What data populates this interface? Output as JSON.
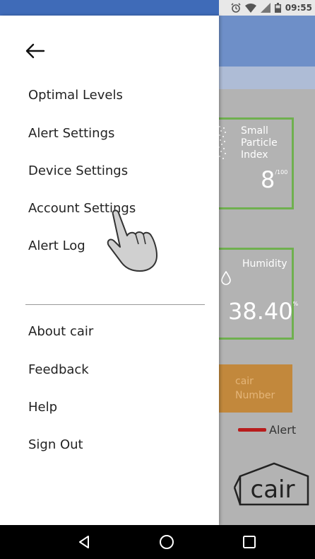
{
  "status_bar": {
    "time": "09:55",
    "icons": [
      "alarm-icon",
      "wifi-icon",
      "signal-icon",
      "battery-icon"
    ]
  },
  "background": {
    "small_particle_card": {
      "label_lines": [
        "Small",
        "Particle",
        "Index"
      ],
      "value": "8",
      "unit": "/100"
    },
    "humidity_card": {
      "label": "Humidity",
      "value": "38.40",
      "unit": "%"
    },
    "cair_number_box": {
      "lines": [
        "cair",
        "Number"
      ]
    },
    "legend": {
      "label": "Alert",
      "color": "#b81c1c"
    },
    "logo_text": "cair"
  },
  "drawer": {
    "primary_items": [
      {
        "label": "Optimal Levels"
      },
      {
        "label": "Alert Settings"
      },
      {
        "label": "Device Settings"
      },
      {
        "label": "Account Settings"
      },
      {
        "label": "Alert Log"
      }
    ],
    "secondary_items": [
      {
        "label": "About cair"
      },
      {
        "label": "Feedback"
      },
      {
        "label": "Help"
      },
      {
        "label": "Sign Out"
      }
    ]
  },
  "nav_bar": {
    "buttons": [
      "back-triangle-icon",
      "home-circle-icon",
      "recents-square-icon"
    ]
  },
  "colors": {
    "status_blue": "#3f6bb8",
    "app_bar": "#6e8fc8",
    "card_border": "#6fb04f",
    "orange": "#c2883c"
  }
}
